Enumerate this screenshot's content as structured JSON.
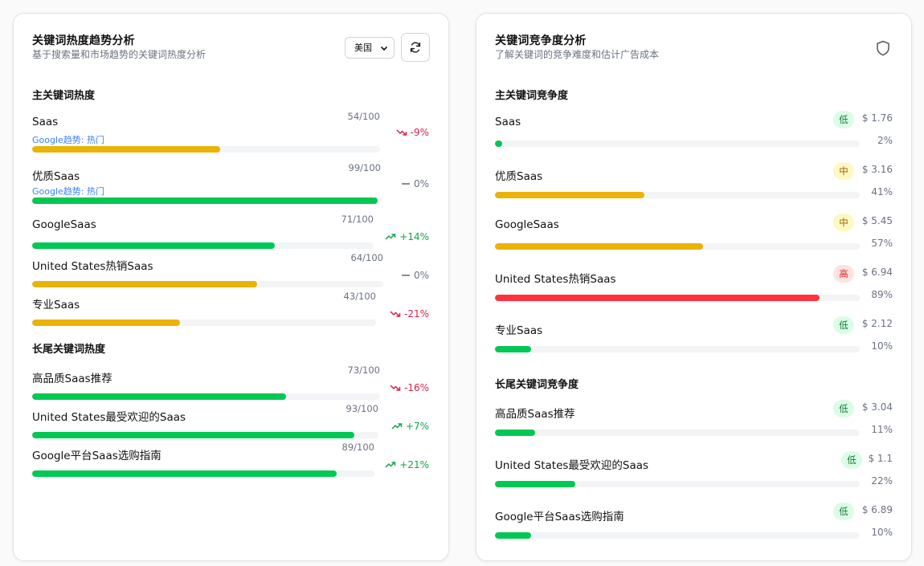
{
  "trend_card": {
    "title": "关键词热度趋势分析",
    "subtitle": "基于搜索量和市场趋势的关键词热度分析",
    "region_select": "美国",
    "main_section": "主关键词热度",
    "long_section": "长尾关键词热度",
    "main_keywords": [
      {
        "keyword": "Saas",
        "score": "54/100",
        "value": 54,
        "google": "Google趋势: 热门",
        "trend": "-9%",
        "dir": "down",
        "color": "#eab308"
      },
      {
        "keyword": "优质Saas",
        "score": "99/100",
        "value": 99,
        "google": "Google趋势: 热门",
        "trend": "0%",
        "dir": "flat",
        "color": "#00c853"
      },
      {
        "keyword": "GoogleSaas",
        "score": "71/100",
        "value": 71,
        "google": "",
        "trend": "+14%",
        "dir": "up",
        "color": "#00c853"
      },
      {
        "keyword": "United States热销Saas",
        "score": "64/100",
        "value": 64,
        "google": "",
        "trend": "0%",
        "dir": "flat",
        "color": "#eab308"
      },
      {
        "keyword": "专业Saas",
        "score": "43/100",
        "value": 43,
        "google": "",
        "trend": "-21%",
        "dir": "down",
        "color": "#eab308"
      }
    ],
    "long_keywords": [
      {
        "keyword": "高品质Saas推荐",
        "score": "73/100",
        "value": 73,
        "trend": "-16%",
        "dir": "down",
        "color": "#00c853"
      },
      {
        "keyword": "United States最受欢迎的Saas",
        "score": "93/100",
        "value": 93,
        "trend": "+7%",
        "dir": "up",
        "color": "#00c853"
      },
      {
        "keyword": "Google平台Saas选购指南",
        "score": "89/100",
        "value": 89,
        "trend": "+21%",
        "dir": "up",
        "color": "#00c853"
      }
    ]
  },
  "comp_card": {
    "title": "关键词竞争度分析",
    "subtitle": "了解关键词的竞争难度和估计广告成本",
    "main_section": "主关键词竞争度",
    "long_section": "长尾关键词竞争度",
    "main_keywords": [
      {
        "keyword": "Saas",
        "level": "低",
        "level_class": "low",
        "cost": "$ 1.76",
        "pct": "2%",
        "value": 2,
        "color": "#00c853"
      },
      {
        "keyword": "优质Saas",
        "level": "中",
        "level_class": "mid",
        "cost": "$ 3.16",
        "pct": "41%",
        "value": 41,
        "color": "#eab308"
      },
      {
        "keyword": "GoogleSaas",
        "level": "中",
        "level_class": "mid",
        "cost": "$ 5.45",
        "pct": "57%",
        "value": 57,
        "color": "#eab308"
      },
      {
        "keyword": "United States热销Saas",
        "level": "高",
        "level_class": "high",
        "cost": "$ 6.94",
        "pct": "89%",
        "value": 89,
        "color": "#ff3340"
      },
      {
        "keyword": "专业Saas",
        "level": "低",
        "level_class": "low",
        "cost": "$ 2.12",
        "pct": "10%",
        "value": 10,
        "color": "#00c853"
      }
    ],
    "long_keywords": [
      {
        "keyword": "高品质Saas推荐",
        "level": "低",
        "level_class": "low",
        "cost": "$ 3.04",
        "pct": "11%",
        "value": 11,
        "color": "#00c853"
      },
      {
        "keyword": "United States最受欢迎的Saas",
        "level": "低",
        "level_class": "low",
        "cost": "$ 1.1",
        "pct": "22%",
        "value": 22,
        "color": "#00c853"
      },
      {
        "keyword": "Google平台Saas选购指南",
        "level": "低",
        "level_class": "low",
        "cost": "$ 6.89",
        "pct": "10%",
        "value": 10,
        "color": "#00c853"
      }
    ]
  }
}
